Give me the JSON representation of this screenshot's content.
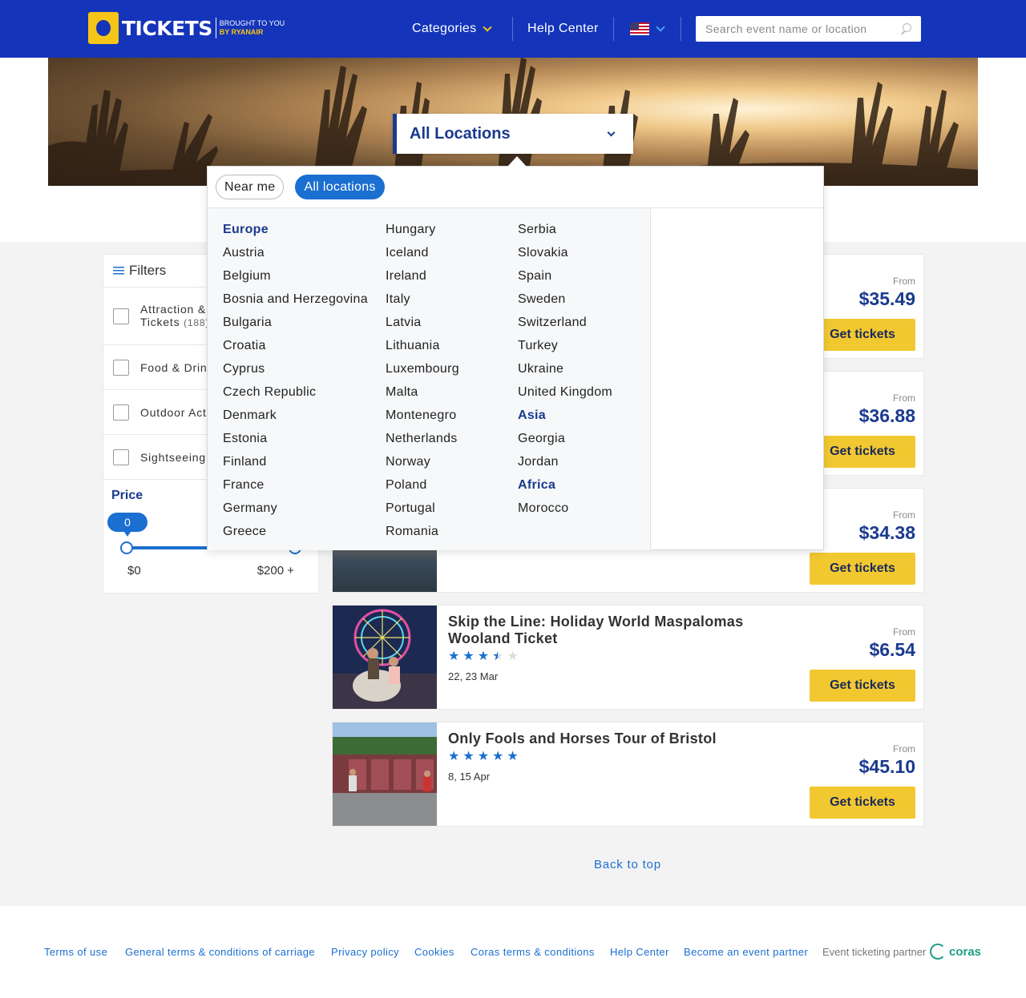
{
  "header": {
    "logo_text": "TICKETS",
    "logo_sub_1": "BROUGHT TO YOU",
    "logo_sub_2": "BY RYANAIR",
    "nav_categories": "Categories",
    "nav_help": "Help Center",
    "locale_icon": "us-flag-icon",
    "search_placeholder": "Search event name or location"
  },
  "hero": {
    "location_select": "All Locations"
  },
  "location_dropdown": {
    "pills": {
      "near_me": "Near me",
      "all_locations": "All locations"
    },
    "columns": [
      [
        {
          "text": "Europe",
          "type": "region"
        },
        {
          "text": "Austria"
        },
        {
          "text": "Belgium"
        },
        {
          "text": "Bosnia and Herzegovina"
        },
        {
          "text": "Bulgaria"
        },
        {
          "text": "Croatia"
        },
        {
          "text": "Cyprus"
        },
        {
          "text": "Czech Republic"
        },
        {
          "text": "Denmark"
        },
        {
          "text": "Estonia"
        },
        {
          "text": "Finland"
        },
        {
          "text": "France"
        },
        {
          "text": "Germany"
        },
        {
          "text": "Greece"
        }
      ],
      [
        {
          "text": "Hungary"
        },
        {
          "text": "Iceland"
        },
        {
          "text": "Ireland"
        },
        {
          "text": "Italy"
        },
        {
          "text": "Latvia"
        },
        {
          "text": "Lithuania"
        },
        {
          "text": "Luxembourg"
        },
        {
          "text": "Malta"
        },
        {
          "text": "Montenegro"
        },
        {
          "text": "Netherlands"
        },
        {
          "text": "Norway"
        },
        {
          "text": "Poland"
        },
        {
          "text": "Portugal"
        },
        {
          "text": "Romania"
        }
      ],
      [
        {
          "text": "Serbia"
        },
        {
          "text": "Slovakia"
        },
        {
          "text": "Spain"
        },
        {
          "text": "Sweden"
        },
        {
          "text": "Switzerland"
        },
        {
          "text": "Turkey"
        },
        {
          "text": "Ukraine"
        },
        {
          "text": "United Kingdom"
        },
        {
          "text": "Asia",
          "type": "region"
        },
        {
          "text": "Georgia"
        },
        {
          "text": "Jordan"
        },
        {
          "text": "Africa",
          "type": "region"
        },
        {
          "text": "Morocco"
        }
      ]
    ]
  },
  "filters": {
    "title": "Filters",
    "items": [
      {
        "label_1": "Attraction &",
        "label_2": "Tickets",
        "count": "(188)"
      },
      {
        "label_1": "Food & Drin"
      },
      {
        "label_1": "Outdoor Act"
      },
      {
        "label_1": "Sightseeing"
      }
    ],
    "price": {
      "title": "Price",
      "current_min": "0",
      "min_label": "$0",
      "max_label": "$200 +"
    }
  },
  "events": [
    {
      "title": "",
      "rating": null,
      "date": "",
      "from_label": "From",
      "price": "$35.49",
      "button": "Get tickets"
    },
    {
      "title": "",
      "rating": null,
      "date": "",
      "from_label": "From",
      "price": "$36.88",
      "button": "Get tickets"
    },
    {
      "title": "",
      "rating": null,
      "date": "",
      "from_label": "From",
      "price": "$34.38",
      "button": "Get tickets"
    },
    {
      "title": "Skip the Line: Holiday World Maspalomas Wooland Ticket",
      "rating": 3.5,
      "date": "22, 23 Mar",
      "from_label": "From",
      "price": "$6.54",
      "button": "Get tickets"
    },
    {
      "title": "Only Fools and Horses Tour of Bristol",
      "rating": 5,
      "date": "8, 15 Apr",
      "from_label": "From",
      "price": "$45.10",
      "button": "Get tickets"
    }
  ],
  "back_to_top": "Back to top",
  "footer": {
    "links": [
      "Terms of use",
      "General terms & conditions of carriage",
      "Privacy policy",
      "Cookies",
      "Coras terms & conditions",
      "Help Center",
      "Become an event partner"
    ],
    "partner_label": "Event ticketing partner",
    "partner_brand": "coras"
  },
  "colors": {
    "header_bg": "#1434ba",
    "accent_blue": "#1a6fd1",
    "navy": "#1a3a8f",
    "cta_yellow": "#f2c830",
    "partner_green": "#1f9e88"
  }
}
